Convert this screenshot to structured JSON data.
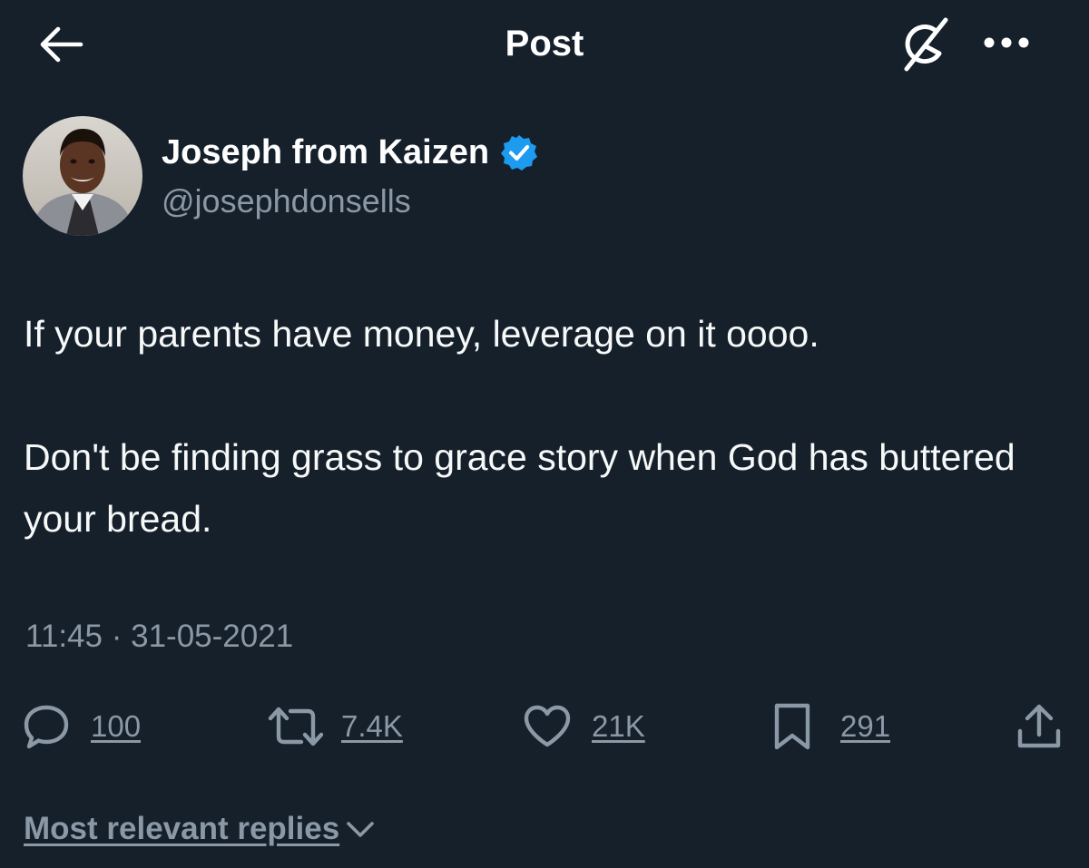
{
  "header": {
    "title": "Post",
    "back_icon": "arrow-left-icon",
    "grok_icon": "grok-slash-icon",
    "more_icon": "more-dots-icon"
  },
  "author": {
    "display_name": "Joseph from Kaizen",
    "handle": "@josephdonsells",
    "verified": true,
    "verified_color": "#1d9bf0"
  },
  "tweet": {
    "paragraphs": [
      "If your parents have money, leverage on it oooo.",
      "Don't be finding grass to grace story when God has buttered your bread."
    ],
    "time": "11:45",
    "date": "31-05-2021",
    "separator": "·"
  },
  "actions": {
    "replies": {
      "count": "100",
      "icon": "reply-bubble-icon"
    },
    "reposts": {
      "count": "7.4K",
      "icon": "repost-icon"
    },
    "likes": {
      "count": "21K",
      "icon": "heart-icon"
    },
    "bookmarks": {
      "count": "291",
      "icon": "bookmark-icon"
    },
    "share": {
      "icon": "share-icon"
    }
  },
  "replies_sort": {
    "label": "Most relevant replies"
  },
  "colors": {
    "background": "#15202b",
    "text_primary": "#ffffff",
    "text_secondary": "#8b98a5",
    "accent": "#1d9bf0"
  }
}
